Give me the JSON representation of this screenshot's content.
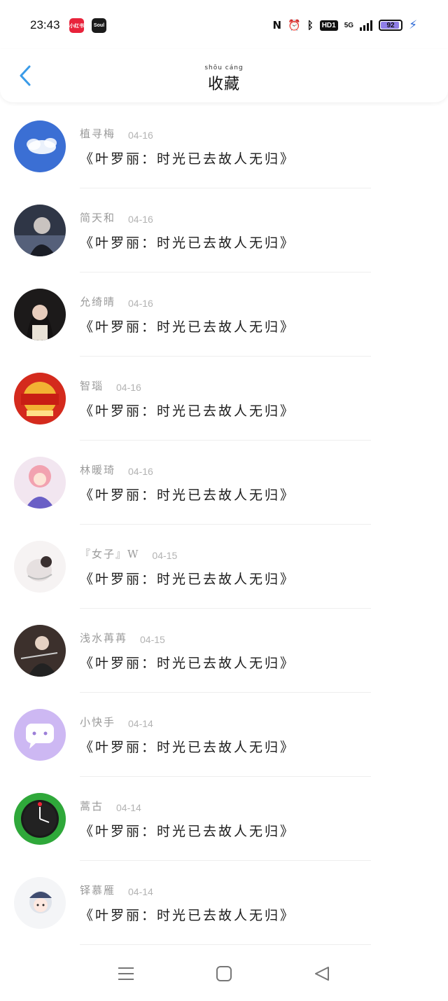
{
  "status_bar": {
    "time": "23:43",
    "apps": [
      "小红书",
      "Soul"
    ],
    "network": "5G",
    "hd_label": "HD1",
    "battery": "92",
    "battery_level": 0.92,
    "accent": "#8f7ee6"
  },
  "header": {
    "title": "收藏",
    "title_pinyin": "shōu cáng",
    "back_icon": "chevron-left-icon",
    "back_color": "#3a9be8"
  },
  "items": [
    {
      "author": "植寻梅",
      "date": "04-16",
      "book": "《叶罗丽：时光已去故人无归》",
      "avatar": "sky-clouds"
    },
    {
      "author": "简天和",
      "date": "04-16",
      "book": "《叶罗丽：时光已去故人无归》",
      "avatar": "anime-dark"
    },
    {
      "author": "允绮晴",
      "date": "04-16",
      "book": "《叶罗丽：时光已去故人无归》",
      "avatar": "girl-photo"
    },
    {
      "author": "智瑙",
      "date": "04-16",
      "book": "《叶罗丽：时光已去故人无归》",
      "avatar": "army-day"
    },
    {
      "author": "林暖琦",
      "date": "04-16",
      "book": "《叶罗丽：时光已去故人无归》",
      "avatar": "anime-pink"
    },
    {
      "author": "『女子』W",
      "date": "04-15",
      "book": "《叶罗丽：时光已去故人无归》",
      "avatar": "sketch-white"
    },
    {
      "author": "浅水苒苒",
      "date": "04-15",
      "book": "《叶罗丽：时光已去故人无归》",
      "avatar": "swordsman"
    },
    {
      "author": "小快手",
      "date": "04-14",
      "book": "《叶罗丽：时光已去故人无归》",
      "avatar": "chat-bubble"
    },
    {
      "author": "蒿古",
      "date": "04-14",
      "book": "《叶罗丽：时光已去故人无归》",
      "avatar": "green-clock"
    },
    {
      "author": "铎慕雁",
      "date": "04-14",
      "book": "《叶罗丽：时光已去故人无归》",
      "avatar": "chibi"
    }
  ],
  "nav": {
    "icons": [
      "menu-icon",
      "home-square-icon",
      "back-triangle-icon"
    ]
  }
}
